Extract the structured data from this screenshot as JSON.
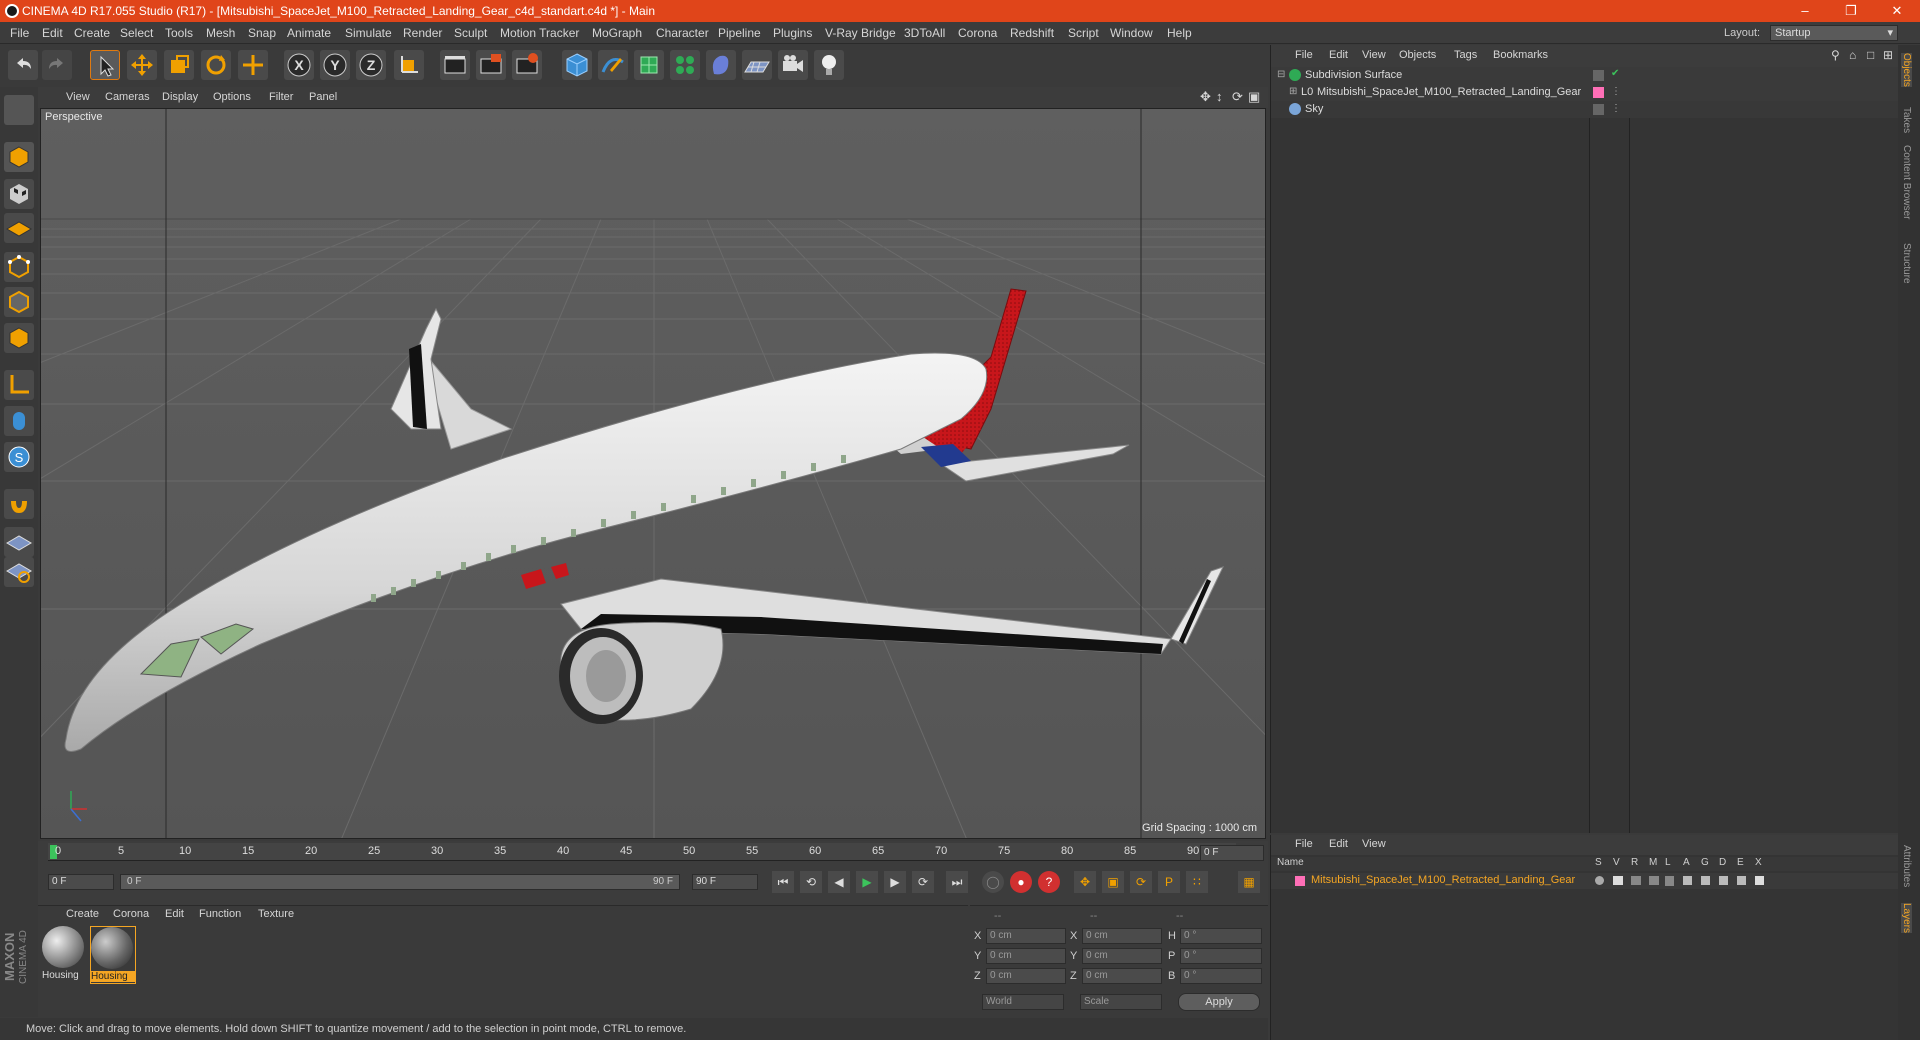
{
  "window": {
    "title": "CINEMA 4D R17.055 Studio (R17) - [Mitsubishi_SpaceJet_M100_Retracted_Landing_Gear_c4d_standart.c4d *] - Main"
  },
  "menubar": {
    "items": [
      "File",
      "Edit",
      "Create",
      "Select",
      "Tools",
      "Mesh",
      "Snap",
      "Animate",
      "Simulate",
      "Render",
      "Sculpt",
      "Motion Tracker",
      "MoGraph",
      "Character",
      "Pipeline",
      "Plugins",
      "V-Ray Bridge",
      "3DToAll",
      "Corona",
      "Redshift",
      "Script",
      "Window",
      "Help"
    ],
    "layout_label": "Layout:",
    "layout_value": "Startup"
  },
  "toolbar": {
    "icons": [
      "undo-icon",
      "redo-icon",
      "select-arrow-icon",
      "move-icon",
      "scale-icon",
      "rotate-icon",
      "transform-icon",
      "x-axis-icon",
      "y-axis-icon",
      "z-axis-icon",
      "coordinate-system-icon",
      "render-view-icon",
      "render-picture-icon",
      "render-settings-icon",
      "cube-primitive-icon",
      "pen-spline-icon",
      "subdivision-icon",
      "cloner-icon",
      "deformer-icon",
      "floor-icon",
      "camera-icon",
      "light-icon"
    ],
    "axis_labels": [
      "X",
      "Y",
      "Z"
    ]
  },
  "viewport": {
    "menu": [
      "View",
      "Cameras",
      "Display",
      "Options",
      "Filter",
      "Panel"
    ],
    "label": "Perspective",
    "grid_spacing": "Grid Spacing : 1000 cm"
  },
  "timeline": {
    "ticks": [
      "0",
      "5",
      "10",
      "15",
      "20",
      "25",
      "30",
      "35",
      "40",
      "45",
      "50",
      "55",
      "60",
      "65",
      "70",
      "75",
      "80",
      "85",
      "90"
    ],
    "current_frame": "0 F",
    "start_frame": "0 F",
    "range_start": "0 F",
    "range_end": "90 F",
    "end_frame": "90 F"
  },
  "materials": {
    "menu": [
      "Create",
      "Corona",
      "Edit",
      "Function",
      "Texture"
    ],
    "items": [
      "Housing",
      "Housing"
    ]
  },
  "coordinates": {
    "headers": [
      "--",
      "--",
      "--"
    ],
    "rows": [
      {
        "a": "X",
        "av": "0 cm",
        "b": "X",
        "bv": "0 cm",
        "c": "H",
        "cv": "0 °"
      },
      {
        "a": "Y",
        "av": "0 cm",
        "b": "Y",
        "bv": "0 cm",
        "c": "P",
        "cv": "0 °"
      },
      {
        "a": "Z",
        "av": "0 cm",
        "b": "Z",
        "bv": "0 cm",
        "c": "B",
        "cv": "0 °"
      }
    ],
    "world": "World",
    "scale": "Scale",
    "apply": "Apply"
  },
  "status": {
    "text": "Move: Click and drag to move elements. Hold down SHIFT to quantize movement / add to the selection in point mode, CTRL to remove."
  },
  "object_manager": {
    "menu": [
      "File",
      "Edit",
      "View",
      "Objects",
      "Tags",
      "Bookmarks"
    ],
    "objects": [
      "Subdivision Surface",
      "Mitsubishi_SpaceJet_M100_Retracted_Landing_Gear",
      "Sky"
    ]
  },
  "layer_manager": {
    "menu": [
      "File",
      "Edit",
      "View"
    ],
    "col_name": "Name",
    "cols": [
      "S",
      "V",
      "R",
      "M",
      "L",
      "A",
      "G",
      "D",
      "E",
      "X"
    ],
    "layer": "Mitsubishi_SpaceJet_M100_Retracted_Landing_Gear"
  },
  "right_tabs": [
    "Objects",
    "Takes",
    "Content Browser",
    "Structure",
    "Attributes",
    "Layers"
  ],
  "logo": {
    "brand": "MAXON",
    "product": "CINEMA 4D"
  },
  "colors": {
    "title_bar": "#e0451a",
    "accent": "#f5a623",
    "tail_red": "#c8161b"
  }
}
